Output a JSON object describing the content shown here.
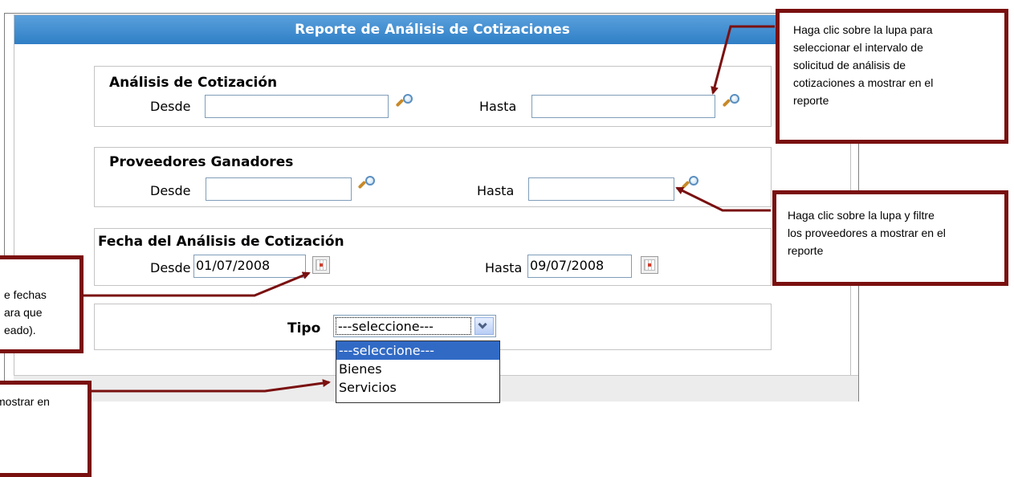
{
  "header": {
    "title": "Reporte de Análisis de Cotizaciones"
  },
  "sections": {
    "analisis": {
      "title": "Análisis de Cotización",
      "desde_label": "Desde",
      "hasta_label": "Hasta",
      "desde_value": "",
      "hasta_value": ""
    },
    "proveedores": {
      "title": "Proveedores Ganadores",
      "desde_label": "Desde",
      "hasta_label": "Hasta",
      "desde_value": "",
      "hasta_value": ""
    },
    "fecha": {
      "title": "Fecha del Análisis de Cotización",
      "desde_label": "Desde",
      "hasta_label": "Hasta",
      "desde_value": "01/07/2008",
      "hasta_value": "09/07/2008"
    },
    "tipo": {
      "label": "Tipo",
      "selected": "---seleccione---",
      "options": [
        "---seleccione---",
        "Bienes",
        "Servicios"
      ]
    }
  },
  "callouts": {
    "lupa_intervalo": "Haga clic sobre  la lupa  para\nseleccionar  el  intervalo  de\nsolicitud  de        análisis  de\ncotizaciones a mostrar en el\nreporte",
    "lupa_proveedores": " Haga clic sobre la lupa y  filtre\nlos proveedores a  mostrar en el\nreporte",
    "fechas": "e fechas\nara  que\neado).",
    "tipo": " mostrar en"
  },
  "colors": {
    "title_bar": "#2f7fc6",
    "callout_border": "#7a1010",
    "arrow": "#7a1010",
    "selected_option": "#316ac5"
  }
}
